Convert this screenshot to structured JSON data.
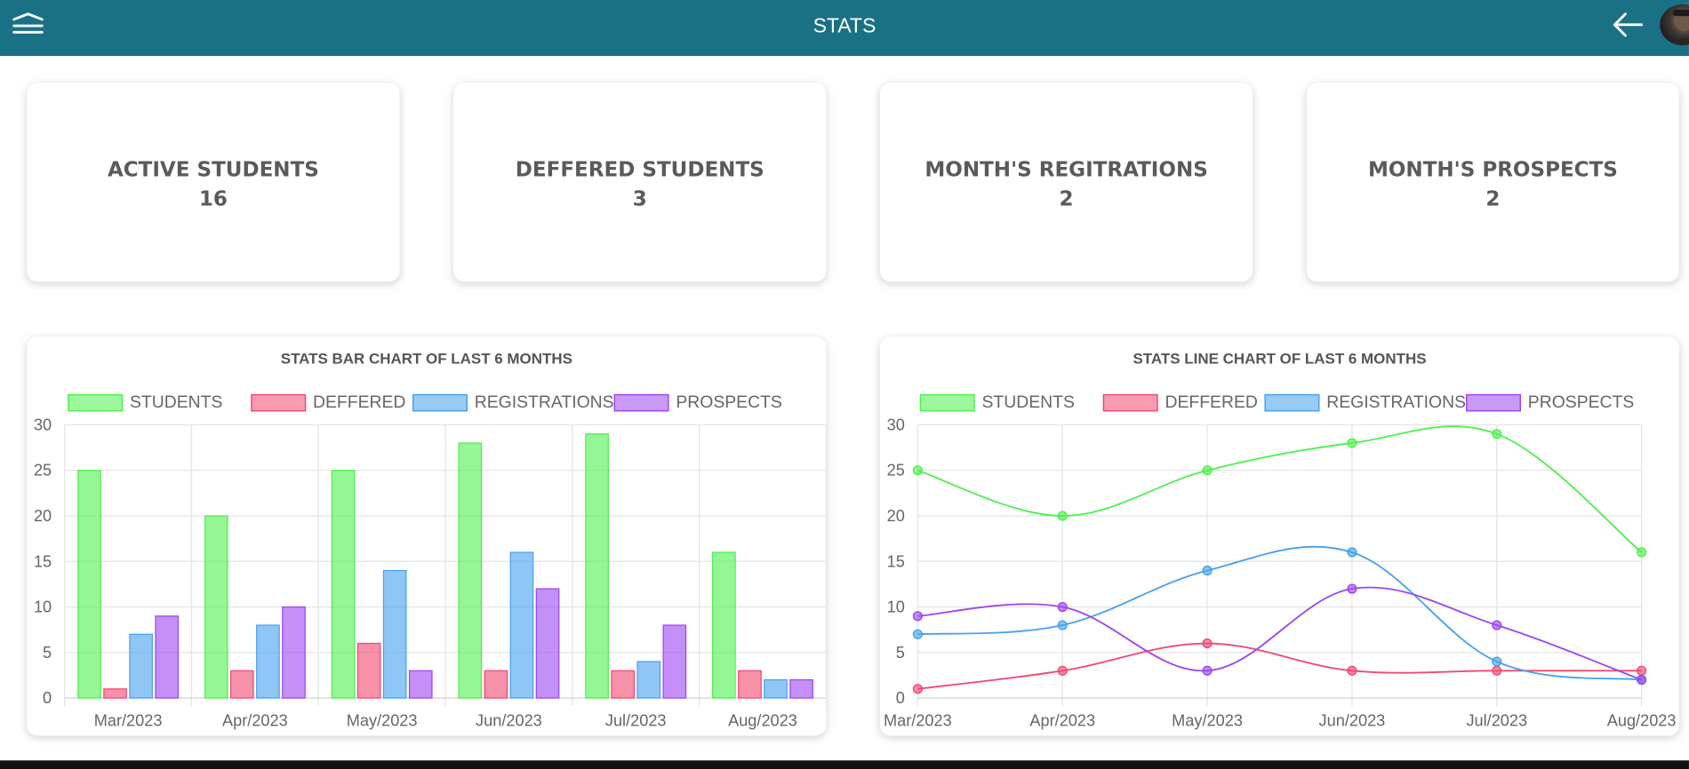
{
  "header": {
    "title": "STATS"
  },
  "icons": {
    "menu": "menu-stack-icon",
    "back": "arrow-left-icon"
  },
  "colors": {
    "header_bg": "#1a7186",
    "students": "#4cf04c",
    "deffered": "#f04870",
    "registrations": "#45a0f0",
    "prospects": "#9c45f0"
  },
  "stats": [
    {
      "label": "ACTIVE STUDENTS",
      "value": "16"
    },
    {
      "label": "DEFFERED STUDENTS",
      "value": "3"
    },
    {
      "label": "MONTH'S REGITRATIONS",
      "value": "2"
    },
    {
      "label": "MONTH'S PROSPECTS",
      "value": "2"
    }
  ],
  "chart_data": [
    {
      "type": "bar",
      "title": "STATS BAR CHART OF LAST 6 MONTHS",
      "categories": [
        "Mar/2023",
        "Apr/2023",
        "May/2023",
        "Jun/2023",
        "Jul/2023",
        "Aug/2023"
      ],
      "series": [
        {
          "name": "STUDENTS",
          "values": [
            25,
            20,
            25,
            28,
            29,
            16
          ]
        },
        {
          "name": "DEFFERED",
          "values": [
            1,
            3,
            6,
            3,
            3,
            3
          ]
        },
        {
          "name": "REGISTRATIONS",
          "values": [
            7,
            8,
            14,
            16,
            4,
            2
          ]
        },
        {
          "name": "PROSPECTS",
          "values": [
            9,
            10,
            3,
            12,
            8,
            2
          ]
        }
      ],
      "ylim": [
        0,
        30
      ],
      "yticks": [
        0,
        5,
        10,
        15,
        20,
        25,
        30
      ],
      "grid": true,
      "legend": "top"
    },
    {
      "type": "line",
      "title": "STATS LINE CHART OF LAST 6 MONTHS",
      "categories": [
        "Mar/2023",
        "Apr/2023",
        "May/2023",
        "Jun/2023",
        "Jul/2023",
        "Aug/2023"
      ],
      "series": [
        {
          "name": "STUDENTS",
          "values": [
            25,
            20,
            25,
            28,
            29,
            16
          ]
        },
        {
          "name": "DEFFERED",
          "values": [
            1,
            3,
            6,
            3,
            3,
            3
          ]
        },
        {
          "name": "REGISTRATIONS",
          "values": [
            7,
            8,
            14,
            16,
            4,
            2
          ]
        },
        {
          "name": "PROSPECTS",
          "values": [
            9,
            10,
            3,
            12,
            8,
            2
          ]
        }
      ],
      "ylim": [
        0,
        30
      ],
      "yticks": [
        0,
        5,
        10,
        15,
        20,
        25,
        30
      ],
      "grid": true,
      "legend": "top"
    }
  ]
}
